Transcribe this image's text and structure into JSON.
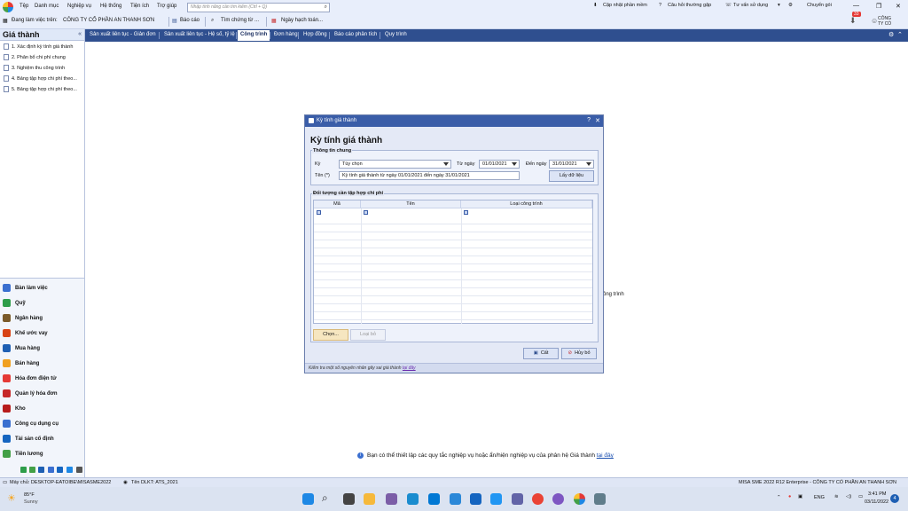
{
  "menu": [
    "Tệp",
    "Danh mục",
    "Nghiệp vụ",
    "Hệ thống",
    "Tiện ích",
    "Trợ giúp"
  ],
  "search": {
    "placeholder": "Nhập tính năng cần tìm kiếm (Ctrl + Q)"
  },
  "topright": {
    "update": "Cập nhật phần mềm",
    "faq": "Câu hỏi thường gặp",
    "consult": "Tư vấn sử dụng",
    "switch": "Chuyển gói",
    "badge": "33",
    "company_short": "CÔNG TY CỔ"
  },
  "toolbar": {
    "working_on_label": "Đang làm việc trên:",
    "company": "CÔNG TY CỔ PHẦN AN THANH SƠN",
    "report": "Báo cáo",
    "find_doc": "Tìm chứng từ ...",
    "posting_date": "Ngày hạch toán..."
  },
  "sidebar": {
    "title": "Giá thành",
    "collapse": "«",
    "items": [
      "1. Xác định kỳ tính giá thành",
      "2. Phân bổ chi phí chung",
      "3. Nghiệm thu công trình",
      "4. Bảng tập hợp chi phí theo...",
      "5. Bảng tập hợp chi phí theo..."
    ],
    "modules": [
      "Bàn làm việc",
      "Quỹ",
      "Ngân hàng",
      "Khế ước vay",
      "Mua hàng",
      "Bán hàng",
      "Hóa đơn điện tử",
      "Quản lý hóa đơn",
      "Kho",
      "Công cụ dụng cụ",
      "Tài sản cố định",
      "Tiền lương"
    ]
  },
  "tabs": [
    "Sản xuất liên tục - Giản đơn",
    "Sản xuất liên tục - Hệ số, tỷ lệ",
    "Công trình",
    "Đơn hàng",
    "Hợp đồng",
    "Báo cáo phân tích",
    "Quy trình"
  ],
  "active_tab": "Công trình",
  "dialog": {
    "window_title": "Kỳ tính giá thành",
    "help": "?",
    "close": "✕",
    "heading": "Kỳ tính giá thành",
    "general_group": "Thông tin chung",
    "period_label": "Kỳ",
    "period_value": "Tùy chọn",
    "from_label": "Từ ngày",
    "from_value": "01/01/2021",
    "to_label": "Đến ngày",
    "to_value": "31/01/2021",
    "name_label": "Tên (*)",
    "name_value": "Kỳ tính giá thành từ ngày 01/01/2021 đến ngày 31/01/2021",
    "fetch_button": "Lấy dữ liệu",
    "objects_group": "Đối tượng cần tập hợp chi phí",
    "columns": [
      "Mã",
      "Tên",
      "Loại công trình"
    ],
    "choose_button": "Chọn...",
    "remove_button": "Loại bỏ",
    "save_button": "Cất",
    "cancel_button": "Hủy bỏ",
    "footer_text": "Kiểm tra một số nguyên nhân gây sai giá thành ",
    "footer_link": "tại đây"
  },
  "background_fragment": "ông trình",
  "info": {
    "text": "Bạn có thể thiết lập các quy tắc nghiệp vụ hoặc ẩn/hiện nghiệp vụ của phân hệ Giá thành ",
    "link": "tại đây"
  },
  "statusbar": {
    "server": "Máy chủ: DESKTOP-EATOIBE\\MISASME2022",
    "db": "Tên DLKT: ATS_2021",
    "product": "MISA SME 2022 R12 Enterprise - CÔNG TY CỔ PHẦN AN THANH SƠN"
  },
  "taskbar": {
    "temp": "85°F",
    "weather": "Sunny",
    "lang": "ENG",
    "time": "3:41 PM",
    "date": "03/11/2022",
    "notif": "4"
  },
  "colors": {
    "accent": "#2f4f8f",
    "dialog_title": "#3a5da8",
    "badge": "#e53935"
  }
}
